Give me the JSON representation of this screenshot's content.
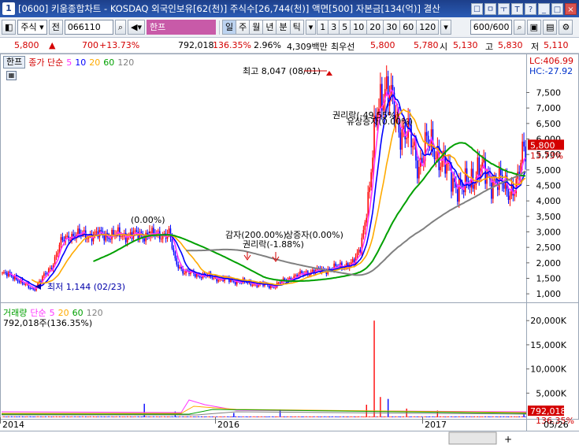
{
  "window": {
    "number": "1",
    "title": "[0600] 키움종합차트 - KOSDAQ 외국인보유[62(천)] 주식수[26,744(천)] 액면[500] 자본금[134(억)] 결산",
    "icons": [
      "☐",
      "ㅁ",
      "ㅜ",
      "T",
      "?",
      "_",
      "□",
      "×"
    ]
  },
  "toolbar": {
    "type_select": "주식",
    "jeon": "전",
    "code": "066110",
    "stock_name": "한프",
    "periods": [
      "일",
      "주",
      "월",
      "년",
      "분",
      "틱"
    ],
    "intervals": [
      "1",
      "3",
      "5",
      "10",
      "20",
      "30",
      "60",
      "120"
    ],
    "count": "600/600"
  },
  "quote": {
    "price": "5,800",
    "change": "700",
    "change_pct": "+13.73%",
    "volume": "792,018",
    "volume_ratio": "136.35%",
    "turnover": "2.96%",
    "amount": "4,309백만",
    "bid_label": "최우선",
    "ask": "5,800",
    "bid": "5,780",
    "open_label": "시",
    "open": "5,130",
    "high_label": "고",
    "high": "5,830",
    "low_label": "저",
    "low": "5,110"
  },
  "price_panel": {
    "tag": "한프",
    "ind_label": "종가 단순",
    "ma": [
      "5",
      "10",
      "20",
      "60",
      "120"
    ],
    "lc": "LC:406.99",
    "hc": "HC:-27.92",
    "last_price": "5,800",
    "last_pct": "13.73%",
    "high_ann": "최고 8,047 (08/01)",
    "low_ann": "최저 1,144 (02/23)",
    "ann_zero": "(0.00%)",
    "ann_gamja": "감자(200.00%)",
    "ann_rights": "권리락(-1.88%)",
    "ann_sangjeung": "상증자(0.00%)",
    "ann_rights2": "권리락(-49.55%)",
    "ann_sangjeung2": "유상증자(0.00%)"
  },
  "volume_panel": {
    "tag": "거래량",
    "ind_label": "단순",
    "ma": [
      "5",
      "20",
      "60",
      "120"
    ],
    "current": "792,018주(136.35%)",
    "last_value": "792,018",
    "last_pct": "136.35%"
  },
  "x_axis": {
    "labels": [
      "2014",
      "2016",
      "2017"
    ],
    "last_date": "05/26"
  },
  "chart_data": {
    "type": "line",
    "price_axis": {
      "ticks": [
        "7,500",
        "7,000",
        "6,500",
        "6,000",
        "5,500",
        "5,000",
        "4,500",
        "4,000",
        "3,500",
        "3,000",
        "2,500",
        "2,000",
        "1,500",
        "1,000"
      ]
    },
    "volume_axis": {
      "ticks": [
        "20,000K",
        "15,000K",
        "10,000K",
        "5,000K"
      ]
    },
    "colors": {
      "ma5": "#ff33ff",
      "ma10": "#0000ff",
      "ma20": "#ffaa00",
      "ma60": "#00a000",
      "ma120": "#808080",
      "up": "#ff0000",
      "down": "#0000ff"
    }
  }
}
